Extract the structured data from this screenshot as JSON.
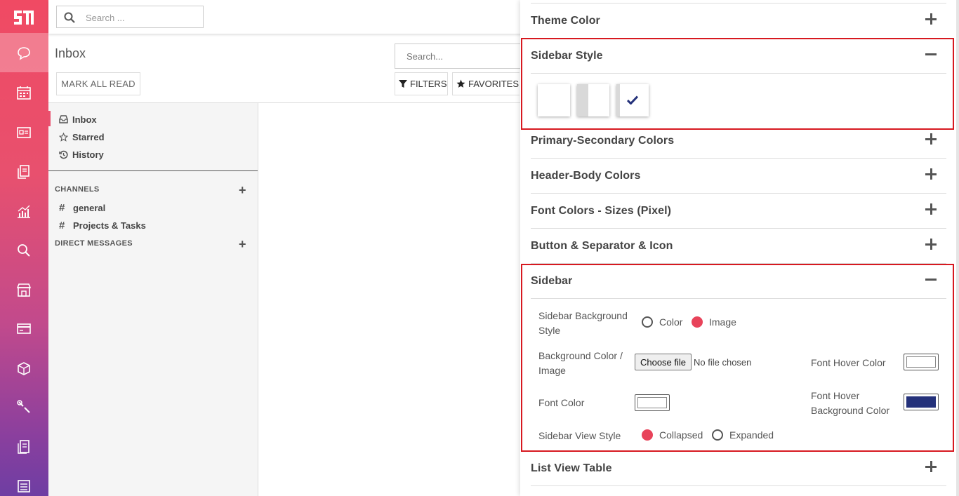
{
  "rail": {
    "logo": "logo-icon",
    "items": [
      "chat-icon",
      "calendar-icon",
      "contacts-icon",
      "documents-icon",
      "reports-icon",
      "search-icon",
      "shop-icon",
      "card-icon",
      "package-icon",
      "tools-icon",
      "receipt-icon",
      "list-icon"
    ]
  },
  "topbar": {
    "search_placeholder": "Search ..."
  },
  "inbox": {
    "title": "Inbox",
    "mark_all_read": "MARK ALL READ",
    "search_placeholder": "Search...",
    "filters_label": "FILTERS",
    "favorites_label": "FAVORITES"
  },
  "sidebar": {
    "nav": [
      {
        "label": "Inbox",
        "icon": "inbox-icon"
      },
      {
        "label": "Starred",
        "icon": "star-icon"
      },
      {
        "label": "History",
        "icon": "history-icon"
      }
    ],
    "channels_title": "CHANNELS",
    "channels": [
      "general",
      "Projects & Tasks"
    ],
    "direct_messages_title": "DIRECT MESSAGES"
  },
  "customizer": {
    "sections": {
      "theme_color": "Theme Color",
      "sidebar_style": "Sidebar Style",
      "primary_secondary": "Primary-Secondary Colors",
      "header_body": "Header-Body Colors",
      "font_colors": "Font Colors - Sizes (Pixel)",
      "button_separator": "Button & Separator & Icon",
      "sidebar": "Sidebar",
      "list_view": "List View Table"
    },
    "sidebar_style_selected": 3,
    "sidebar_fields": {
      "bg_style_label": "Sidebar Background Style",
      "bg_style_options": [
        "Color",
        "Image"
      ],
      "bg_style_selected": "Image",
      "bg_image_label": "Background Color / Image",
      "choose_file": "Choose file",
      "no_file": "No file chosen",
      "font_hover_color_label": "Font Hover Color",
      "font_hover_color": "#ffffff",
      "font_color_label": "Font Color",
      "font_color": "#ffffff",
      "font_hover_bg_label": "Font Hover Background Color",
      "font_hover_bg_color": "#24317a",
      "view_style_label": "Sidebar View Style",
      "view_style_options": [
        "Collapsed",
        "Expanded"
      ],
      "view_style_selected": "Collapsed"
    },
    "highlight_color": "#d71920",
    "accent_color": "#e8435a"
  }
}
